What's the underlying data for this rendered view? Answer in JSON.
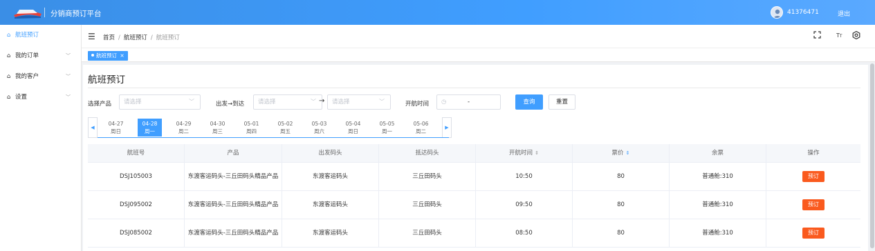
{
  "topbar": {
    "app_title": "分销商预订平台",
    "user_id": "41376471",
    "logout": "退出"
  },
  "sidebar": {
    "items": [
      {
        "label": "航班预订",
        "active": true,
        "expandable": false
      },
      {
        "label": "我的订单",
        "active": false,
        "expandable": true
      },
      {
        "label": "我的客户",
        "active": false,
        "expandable": true
      },
      {
        "label": "设置",
        "active": false,
        "expandable": true
      }
    ]
  },
  "header": {
    "breadcrumb": [
      "首页",
      "航班预订",
      "航班预订"
    ],
    "icons": [
      "fullscreen-icon",
      "font-size-icon",
      "settings-icon"
    ]
  },
  "tabs": [
    {
      "label": "航班预订",
      "close": "×"
    }
  ],
  "page": {
    "title": "航班预订"
  },
  "filters": {
    "product_label": "选择产品",
    "product_placeholder": "请选择",
    "route_label": "出发→到达",
    "from_placeholder": "请选择",
    "to_placeholder": "请选择",
    "route_arrow": "→",
    "time_label": "开航时间",
    "time_sep": "-",
    "search_label": "查询",
    "reset_label": "重置"
  },
  "dates": [
    {
      "date": "04-27",
      "weekday": "周日",
      "active": false
    },
    {
      "date": "04-28",
      "weekday": "周一",
      "active": true
    },
    {
      "date": "04-29",
      "weekday": "周二",
      "active": false
    },
    {
      "date": "04-30",
      "weekday": "周三",
      "active": false
    },
    {
      "date": "05-01",
      "weekday": "周四",
      "active": false
    },
    {
      "date": "05-02",
      "weekday": "周五",
      "active": false
    },
    {
      "date": "05-03",
      "weekday": "周六",
      "active": false
    },
    {
      "date": "05-04",
      "weekday": "周日",
      "active": false
    },
    {
      "date": "05-05",
      "weekday": "周一",
      "active": false
    },
    {
      "date": "05-06",
      "weekday": "周二",
      "active": false
    }
  ],
  "table": {
    "columns": [
      "航班号",
      "产品",
      "出发码头",
      "抵达码头",
      "开航时间",
      "票价",
      "余票",
      "操作"
    ],
    "rows": [
      {
        "flight": "DSJ105003",
        "product": "东渡客运码头-三丘田码头精品产品",
        "from": "东渡客运码头",
        "to": "三丘田码头",
        "time": "10:50",
        "price": "80",
        "remaining": "普通舱:310",
        "action": "预订"
      },
      {
        "flight": "DSJ095002",
        "product": "东渡客运码头-三丘田码头精品产品",
        "from": "东渡客运码头",
        "to": "三丘田码头",
        "time": "09:50",
        "price": "80",
        "remaining": "普通舱:310",
        "action": "预订"
      },
      {
        "flight": "DSJ085002",
        "product": "东渡客运码头-三丘田码头精品产品",
        "from": "东渡客运码头",
        "to": "三丘田码头",
        "time": "08:50",
        "price": "80",
        "remaining": "普通舱:310",
        "action": "预订"
      }
    ]
  },
  "colors": {
    "primary": "#409eff",
    "book_button": "#fa5a1e"
  }
}
